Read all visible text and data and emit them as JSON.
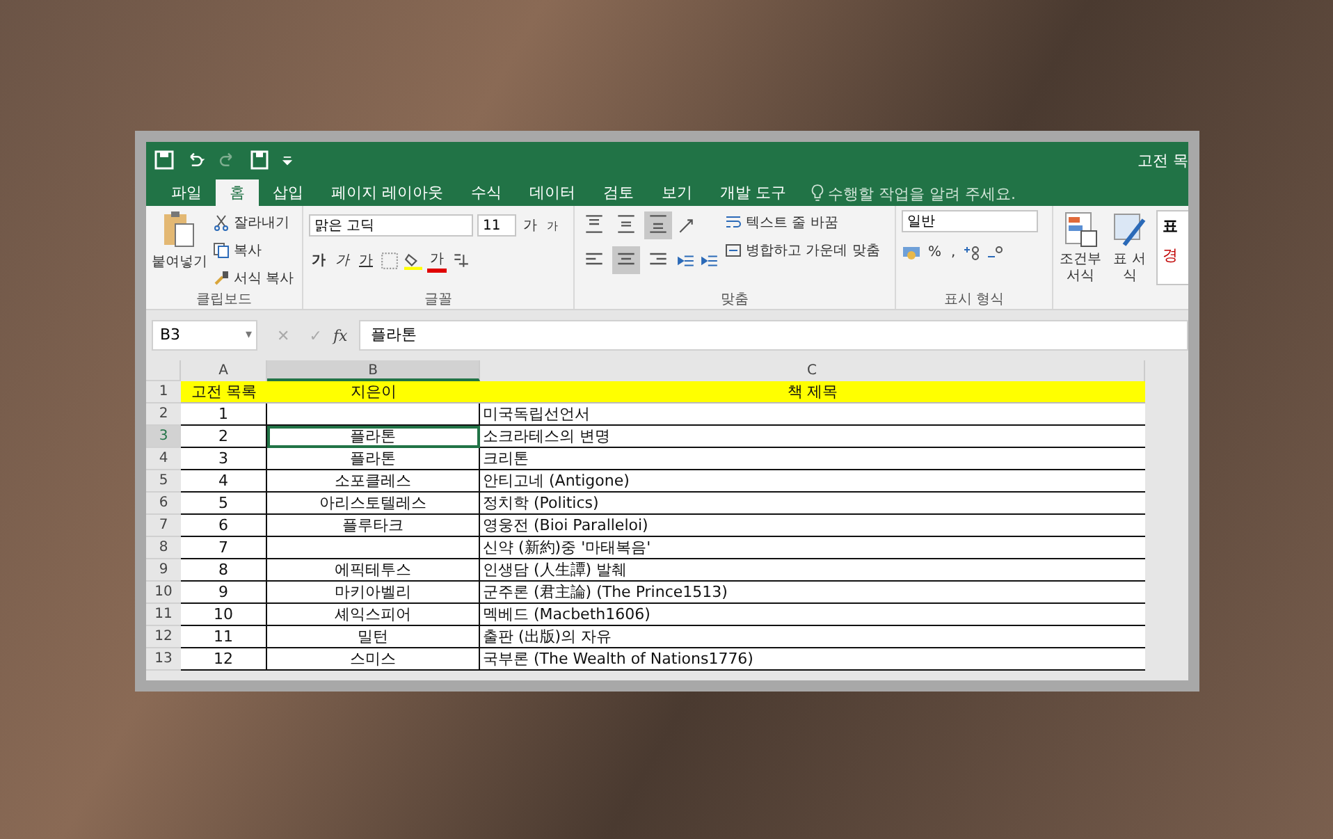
{
  "window": {
    "title": "고전 목"
  },
  "tabs": [
    {
      "label": "파일",
      "selected": false
    },
    {
      "label": "홈",
      "selected": true
    },
    {
      "label": "삽입",
      "selected": false
    },
    {
      "label": "페이지 레이아웃",
      "selected": false
    },
    {
      "label": "수식",
      "selected": false
    },
    {
      "label": "데이터",
      "selected": false
    },
    {
      "label": "검토",
      "selected": false
    },
    {
      "label": "보기",
      "selected": false
    },
    {
      "label": "개발 도구",
      "selected": false
    }
  ],
  "tell_me": {
    "placeholder": "수행할 작업을 알려 주세요."
  },
  "ribbon": {
    "clipboard": {
      "paste": "붙여넣기",
      "cut": "잘라내기",
      "copy": "복사",
      "painter": "서식 복사",
      "label": "클립보드"
    },
    "font": {
      "name": "맑은 고딕",
      "size": "11",
      "grow": "가",
      "shrink": "가",
      "bold": "가",
      "italic": "가",
      "underline": "가",
      "font_color": "가",
      "label": "글꼴"
    },
    "alignment": {
      "vertical": [
        {
          "selected": false
        },
        {
          "selected": false
        },
        {
          "selected": true
        }
      ],
      "horizontal": [
        {
          "selected": false
        },
        {
          "selected": true
        },
        {
          "selected": false
        }
      ],
      "wrap": "텍스트 줄 바꿈",
      "merge": "병합하고 가운데 맞춤",
      "label": "맞춤"
    },
    "number": {
      "format": "일반",
      "percent": "%",
      "comma": ",",
      "label": "표시 형식"
    },
    "styles": {
      "conditional": "조건부 서식",
      "table": "표 서식",
      "cell_1": "표",
      "cell_2": "경"
    }
  },
  "formula_bar": {
    "name_box": "B3",
    "dropdown": "▾",
    "cancel": "✕",
    "enter": "✓",
    "function": "fx",
    "value": "플라톤"
  },
  "sheet": {
    "columns": [
      {
        "label": "A",
        "selected": false
      },
      {
        "label": "B",
        "selected": true
      },
      {
        "label": "C",
        "selected": false
      }
    ],
    "rows": [
      {
        "number": "1",
        "kind": "header",
        "selected": false,
        "cells": [
          "고전 목록",
          "지은이",
          "책 제목"
        ]
      },
      {
        "number": "2",
        "kind": "data",
        "selected": false,
        "cells": [
          "1",
          "",
          "미국독립선언서"
        ]
      },
      {
        "number": "3",
        "kind": "data",
        "selected": true,
        "cells": [
          "2",
          "플라톤",
          "소크라테스의 변명"
        ]
      },
      {
        "number": "4",
        "kind": "data",
        "selected": false,
        "cells": [
          "3",
          "플라톤",
          "크리톤"
        ]
      },
      {
        "number": "5",
        "kind": "data",
        "selected": false,
        "cells": [
          "4",
          "소포클레스",
          "안티고네 (Antigone)"
        ]
      },
      {
        "number": "6",
        "kind": "data",
        "selected": false,
        "cells": [
          "5",
          "아리스토텔레스",
          "정치학 (Politics)"
        ]
      },
      {
        "number": "7",
        "kind": "data",
        "selected": false,
        "cells": [
          "6",
          "플루타크",
          "영웅전 (Bioi Paralleloi)"
        ]
      },
      {
        "number": "8",
        "kind": "data",
        "selected": false,
        "cells": [
          "7",
          "",
          "신약 (新約)중 '마태복음'"
        ]
      },
      {
        "number": "9",
        "kind": "data",
        "selected": false,
        "cells": [
          "8",
          "에픽테투스",
          "인생담 (人生譚) 발췌"
        ]
      },
      {
        "number": "10",
        "kind": "data",
        "selected": false,
        "cells": [
          "9",
          "마키아벨리",
          "군주론 (君主論) (The Prince1513)"
        ]
      },
      {
        "number": "11",
        "kind": "data",
        "selected": false,
        "cells": [
          "10",
          "셰익스피어",
          "멕베드 (Macbeth1606)"
        ]
      },
      {
        "number": "12",
        "kind": "data",
        "selected": false,
        "cells": [
          "11",
          "밀턴",
          "출판 (出版)의 자유"
        ]
      },
      {
        "number": "13",
        "kind": "data",
        "selected": false,
        "cells": [
          "12",
          "스미스",
          "국부론 (The Wealth of Nations1776)"
        ]
      }
    ]
  }
}
